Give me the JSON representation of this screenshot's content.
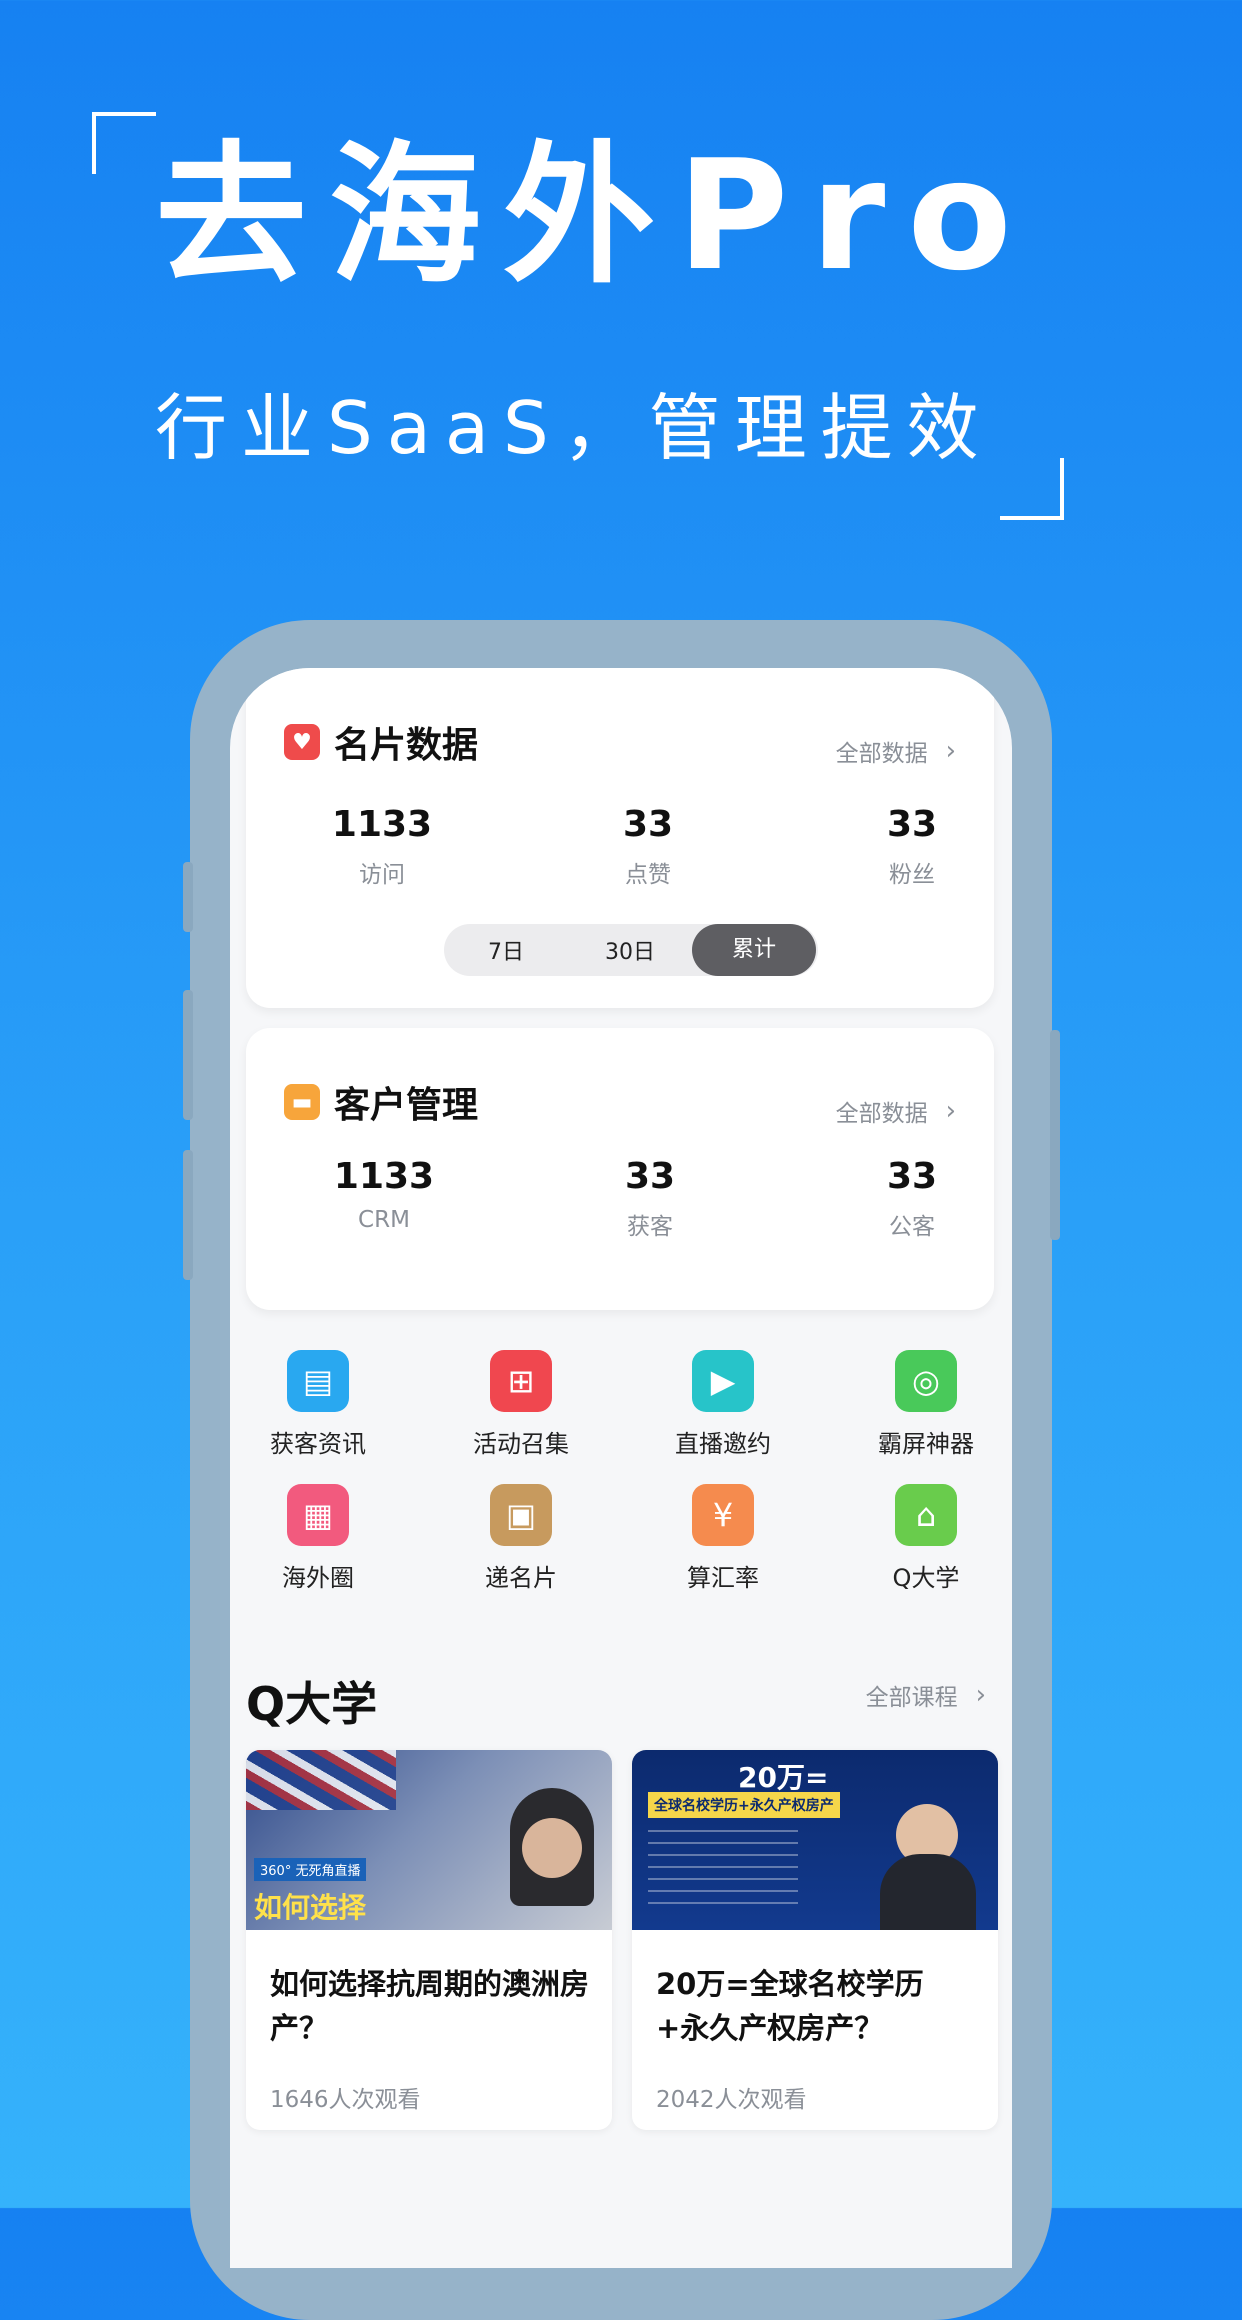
{
  "hero": {
    "title": "去海外Pro",
    "subtitle": "行业SaaS，管理提效"
  },
  "card_stats": {
    "title": "名片数据",
    "icon": "heart-icon",
    "link": "全部数据",
    "stats": [
      {
        "value": "1133",
        "label": "访问"
      },
      {
        "value": "33",
        "label": "点赞"
      },
      {
        "value": "33",
        "label": "粉丝"
      }
    ],
    "ranges": [
      "7日",
      "30日",
      "累计"
    ],
    "selected_range": "累计"
  },
  "customer": {
    "title": "客户管理",
    "icon": "folder-icon",
    "link": "全部数据",
    "stats": [
      {
        "value": "1133",
        "label": "CRM"
      },
      {
        "value": "33",
        "label": "获客"
      },
      {
        "value": "33",
        "label": "公客"
      }
    ]
  },
  "tools": [
    {
      "label": "获客资讯",
      "icon": "document-icon",
      "color": "#29a8f0"
    },
    {
      "label": "活动召集",
      "icon": "gift-icon",
      "color": "#f0474f"
    },
    {
      "label": "直播邀约",
      "icon": "play-icon",
      "color": "#27c4c9"
    },
    {
      "label": "霸屏神器",
      "icon": "ring-icon",
      "color": "#49c95a"
    },
    {
      "label": "海外圈",
      "icon": "grid-icon",
      "color": "#f25a7e"
    },
    {
      "label": "递名片",
      "icon": "id-card-icon",
      "color": "#c79a5e"
    },
    {
      "label": "算汇率",
      "icon": "yen-icon",
      "color": "#f58b4e"
    },
    {
      "label": "Q大学",
      "icon": "university-icon",
      "color": "#69cc4c"
    }
  ],
  "university": {
    "title": "Q大学",
    "link": "全部课程",
    "courses": [
      {
        "title": "如何选择抗周期的澳洲房产？",
        "views": "1646人次观看",
        "thumb_text": "如何选择",
        "thumb_badge": "360° 无死角直播"
      },
      {
        "title": "20万=全球名校学历+永久产权房产？",
        "views": "2042人次观看",
        "thumb_text": "20万=",
        "thumb_badge": "全球名校学历+永久产权房产"
      }
    ]
  },
  "colors": {
    "bg_top": "#1681f2",
    "bg_bottom": "#35b2fb",
    "heart": "#ef4b4b",
    "folder": "#f7a53b"
  }
}
